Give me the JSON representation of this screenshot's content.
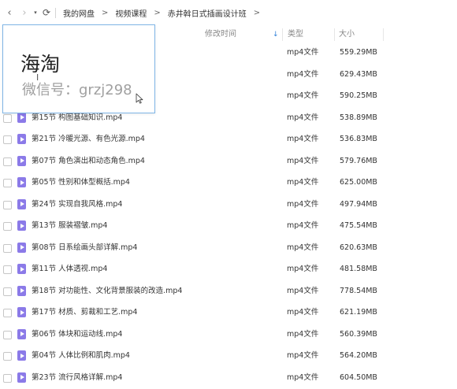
{
  "nav": {
    "back_icon": "‹",
    "forward_icon": "›",
    "dropdown_icon": "▾",
    "refresh_icon": "⟳",
    "breadcrumbs": [
      "我的网盘",
      "视频课程",
      "赤井斡日式插画设计班"
    ],
    "separator": ">"
  },
  "columns": {
    "modified": "修改时间",
    "sort_icon": "↓",
    "type": "类型",
    "size": "大小"
  },
  "overlay": {
    "title": "海淘",
    "subtitle": "微信号：grzj298",
    "caret": "I"
  },
  "files": [
    {
      "name": "",
      "type": "mp4文件",
      "size": "559.29MB"
    },
    {
      "name": "",
      "type": "mp4文件",
      "size": "629.43MB"
    },
    {
      "name": "",
      "type": "mp4文件",
      "size": "590.25MB"
    },
    {
      "name": "第15节 构图基础知识.mp4",
      "type": "mp4文件",
      "size": "538.89MB"
    },
    {
      "name": "第21节 冷暖光源、有色光源.mp4",
      "type": "mp4文件",
      "size": "536.83MB"
    },
    {
      "name": "第07节 角色演出和动态角色.mp4",
      "type": "mp4文件",
      "size": "579.76MB"
    },
    {
      "name": "第05节 性别和体型概括.mp4",
      "type": "mp4文件",
      "size": "625.00MB"
    },
    {
      "name": "第24节 实现自我风格.mp4",
      "type": "mp4文件",
      "size": "497.94MB"
    },
    {
      "name": "第13节 服装褶皱.mp4",
      "type": "mp4文件",
      "size": "475.54MB"
    },
    {
      "name": "第08节 日系绘画头部详解.mp4",
      "type": "mp4文件",
      "size": "620.63MB"
    },
    {
      "name": "第11节 人体透视.mp4",
      "type": "mp4文件",
      "size": "481.58MB"
    },
    {
      "name": "第18节 对功能性、文化背景服装的改造.mp4",
      "type": "mp4文件",
      "size": "778.54MB"
    },
    {
      "name": "第17节 材质、剪裁和工艺.mp4",
      "type": "mp4文件",
      "size": "621.19MB"
    },
    {
      "name": "第06节 体块和运动线.mp4",
      "type": "mp4文件",
      "size": "560.39MB"
    },
    {
      "name": "第04节 人体比例和肌肉.mp4",
      "type": "mp4文件",
      "size": "564.20MB"
    },
    {
      "name": "第23节 流行风格详解.mp4",
      "type": "mp4文件",
      "size": "604.50MB"
    }
  ]
}
